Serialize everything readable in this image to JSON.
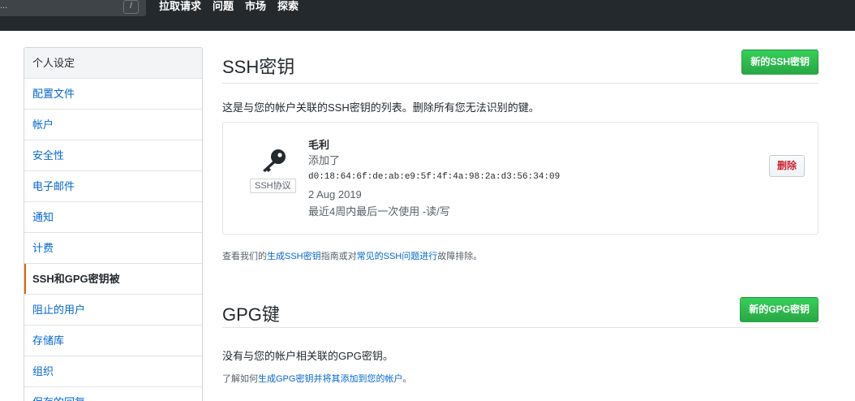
{
  "header": {
    "search_placeholder": "...",
    "slash_key": "/",
    "nav": [
      "拉取请求",
      "问题",
      "市场",
      "探索"
    ]
  },
  "sidebar": {
    "heading": "个人设定",
    "items": [
      {
        "label": "配置文件"
      },
      {
        "label": "帐户"
      },
      {
        "label": "安全性"
      },
      {
        "label": "电子邮件"
      },
      {
        "label": "通知"
      },
      {
        "label": "计费"
      },
      {
        "label": "SSH和GPG密钥被",
        "active": true
      },
      {
        "label": "阻止的用户"
      },
      {
        "label": "存储库"
      },
      {
        "label": "组织"
      },
      {
        "label": "保存的回复"
      }
    ]
  },
  "ssh": {
    "title": "SSH密钥",
    "new_button": "新的SSH密钥",
    "description": "这是与您的帐户关联的SSH密钥的列表。删除所有您无法识别的键。",
    "key": {
      "icon": "key-icon",
      "badge": "SSH协议",
      "name": "毛利",
      "added_label": "添加了",
      "fingerprint": "d0:18:64:6f:de:ab:e9:5f:4f:4a:98:2a:d3:56:34:09",
      "date": "2 Aug 2019",
      "last_used": "最近4周内最后一次使用 -读/写",
      "delete_button": "删除"
    },
    "help": {
      "prefix": "查看我们的",
      "link1": "生成SSH密钥",
      "middle": "指南或对",
      "link2": "常见的SSH问题进行",
      "suffix": "故障排除。"
    }
  },
  "gpg": {
    "title": "GPG键",
    "new_button": "新的GPG密钥",
    "description": "没有与您的帐户相关联的GPG密钥。",
    "help": {
      "prefix": "了解如何",
      "link": "生成GPG密钥并将其添加到您的帐户",
      "suffix": "。"
    }
  },
  "colors": {
    "accent_green": "#28a745",
    "link_blue": "#0366d6",
    "danger_red": "#cb2431",
    "active_marker": "#e36209"
  }
}
